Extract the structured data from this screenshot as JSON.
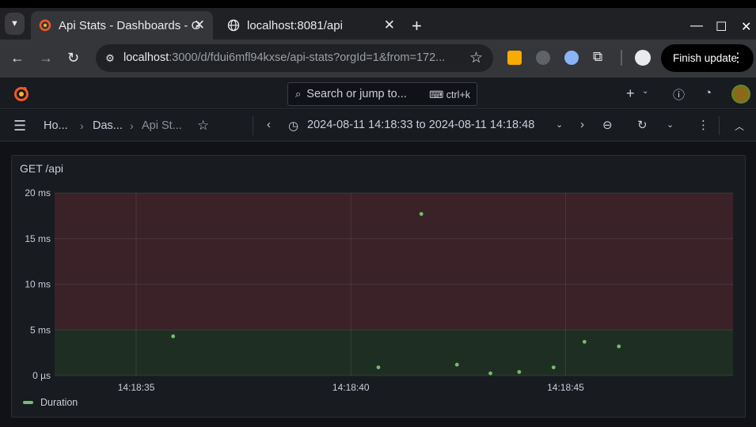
{
  "browser": {
    "tabs": [
      {
        "title": "Api Stats - Dashboards - Grafana",
        "active": true,
        "favicon": "grafana-icon"
      },
      {
        "title": "localhost:8081/api",
        "active": false,
        "favicon": "globe-icon"
      }
    ],
    "url_host": "localhost",
    "url_rest": ":3000/d/fdui6mfl94kxse/api-stats?orgId=1&from=172...",
    "finish_update_label": "Finish update"
  },
  "grafana": {
    "search_placeholder": "Search or jump to...",
    "search_shortcut": "ctrl+k",
    "breadcrumbs": [
      "Ho...",
      "Das...",
      "Api St..."
    ],
    "time_range": "2024-08-11 14:18:33 to 2024-08-11 14:18:48"
  },
  "panel": {
    "title": "GET /api",
    "legend": "Duration"
  },
  "colors": {
    "series": "#73bf69",
    "threshold_red": "#3a2228",
    "threshold_green": "#1f2e23",
    "grafana_orange": "#f05a28"
  },
  "chart_data": {
    "type": "scatter",
    "title": "GET /api",
    "xlabel": "",
    "ylabel": "",
    "xlim": [
      "14:18:33.1",
      "14:18:48.9"
    ],
    "ylim": [
      0,
      20
    ],
    "y_unit": "ms",
    "y_ticks": [
      "0 µs",
      "5 ms",
      "10 ms",
      "15 ms",
      "20 ms"
    ],
    "y_tick_values": [
      0,
      5,
      10,
      15,
      20
    ],
    "x_ticks": [
      "14:18:35",
      "14:18:40",
      "14:18:45"
    ],
    "x_tick_values": [
      35,
      40,
      45
    ],
    "thresholds": [
      {
        "from": 0,
        "to": 5,
        "color": "green"
      },
      {
        "from": 5,
        "to": 20,
        "color": "red"
      }
    ],
    "grid": true,
    "legend_position": "bottom-left",
    "series": [
      {
        "name": "Duration",
        "points": [
          {
            "t": 35.86,
            "y": 4.3
          },
          {
            "t": 40.64,
            "y": 0.9
          },
          {
            "t": 41.64,
            "y": 17.7
          },
          {
            "t": 42.47,
            "y": 1.2
          },
          {
            "t": 43.25,
            "y": 0.25
          },
          {
            "t": 43.92,
            "y": 0.4
          },
          {
            "t": 44.72,
            "y": 0.9
          },
          {
            "t": 45.44,
            "y": 3.7
          },
          {
            "t": 46.24,
            "y": 3.2
          }
        ]
      }
    ]
  }
}
